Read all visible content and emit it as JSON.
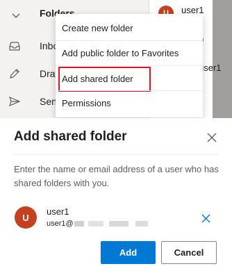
{
  "background": {
    "nav_items": [
      {
        "label": "Folders",
        "icon": "chevron-down-icon"
      },
      {
        "label": "Inbox",
        "icon": "inbox-icon"
      },
      {
        "label": "Drafts",
        "icon": "pencil-icon"
      },
      {
        "label": "Sent Items",
        "icon": "send-icon"
      }
    ],
    "avatar_initial": "U",
    "list_user_top": "user1",
    "list_user_mid": "user1",
    "list_fragment": "p"
  },
  "context_menu": {
    "items": [
      {
        "label": "Create new folder",
        "highlighted": false
      },
      {
        "label": "Add public folder to Favorites",
        "highlighted": false
      },
      {
        "label": "Add shared folder",
        "highlighted": true
      },
      {
        "label": "Permissions",
        "highlighted": false
      }
    ],
    "highlight_color": "#e81123"
  },
  "dialog": {
    "title": "Add shared folder",
    "description": "Enter the name or email address of a user who has shared folders with you.",
    "user": {
      "initial": "U",
      "name": "user1",
      "email_prefix": "user1@"
    },
    "buttons": {
      "add": "Add",
      "cancel": "Cancel"
    },
    "icons": {
      "close": "close-icon",
      "remove": "remove-icon"
    }
  },
  "colors": {
    "accent": "#0078d4",
    "avatar": "#c4401f",
    "nav_bg": "#f4f2f0"
  }
}
